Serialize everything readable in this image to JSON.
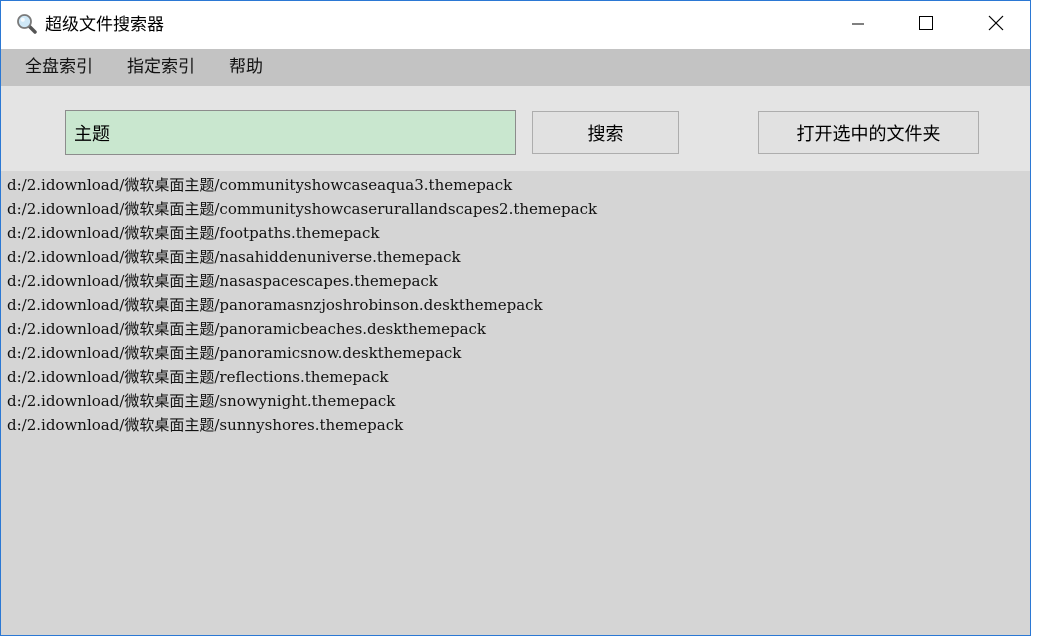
{
  "window": {
    "title": "超级文件搜索器",
    "app_icon": "magnifier-icon",
    "controls": {
      "minimize_icon": "minimize-icon",
      "maximize_icon": "maximize-icon",
      "close_icon": "close-icon"
    }
  },
  "menu": {
    "items": [
      {
        "label": "全盘索引"
      },
      {
        "label": "指定索引"
      },
      {
        "label": "帮助"
      }
    ]
  },
  "search": {
    "value": "主题",
    "button_label": "搜索",
    "open_folder_label": "打开选中的文件夹"
  },
  "results": [
    "d:/2.idownload/微软桌面主题/communityshowcaseaqua3.themepack",
    "d:/2.idownload/微软桌面主题/communityshowcaserurallandscapes2.themepack",
    "d:/2.idownload/微软桌面主题/footpaths.themepack",
    "d:/2.idownload/微软桌面主题/nasahiddenuniverse.themepack",
    "d:/2.idownload/微软桌面主题/nasaspacescapes.themepack",
    "d:/2.idownload/微软桌面主题/panoramasnzjoshrobinson.deskthemepack",
    "d:/2.idownload/微软桌面主题/panoramicbeaches.deskthemepack",
    "d:/2.idownload/微软桌面主题/panoramicsnow.deskthemepack",
    "d:/2.idownload/微软桌面主题/reflections.themepack",
    "d:/2.idownload/微软桌面主题/snowynight.themepack",
    "d:/2.idownload/微软桌面主题/sunnyshores.themepack"
  ],
  "colors": {
    "window_border": "#2b78d4",
    "menubar_bg": "#c3c3c3",
    "input_bg": "#c9e7cf",
    "results_bg": "#d5d5d5"
  }
}
